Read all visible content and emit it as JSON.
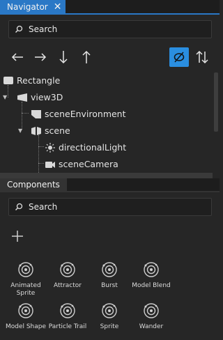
{
  "colors": {
    "accent": "#2a78c6",
    "toggle_active": "#2a8ee0",
    "bg": "#262626"
  },
  "navigator": {
    "tab_label": "Navigator",
    "search_placeholder": "Search",
    "toolbar": {
      "left_icon": "arrow-left-icon",
      "right_icon": "arrow-right-icon",
      "down_icon": "arrow-down-icon",
      "up_icon": "arrow-up-icon",
      "filter_icon": "empty-set-filter-icon",
      "sort_icon": "sort-updown-icon"
    },
    "tree": [
      {
        "label": "Rectangle",
        "icon": "rectangle-icon"
      },
      {
        "label": "view3D",
        "icon": "view3d-icon"
      },
      {
        "label": "sceneEnvironment",
        "icon": "scene-environment-icon"
      },
      {
        "label": "scene",
        "icon": "scene-icon"
      },
      {
        "label": "directionalLight",
        "icon": "light-icon"
      },
      {
        "label": "sceneCamera",
        "icon": "camera-icon"
      }
    ]
  },
  "components": {
    "tab_label": "Components",
    "search_placeholder": "Search",
    "items": [
      {
        "label": "Animated Sprite"
      },
      {
        "label": "Attractor"
      },
      {
        "label": "Burst"
      },
      {
        "label": "Model Blend"
      },
      {
        "label": "Model Shape"
      },
      {
        "label": "Particle Trail"
      },
      {
        "label": "Sprite"
      },
      {
        "label": "Wander"
      }
    ]
  }
}
